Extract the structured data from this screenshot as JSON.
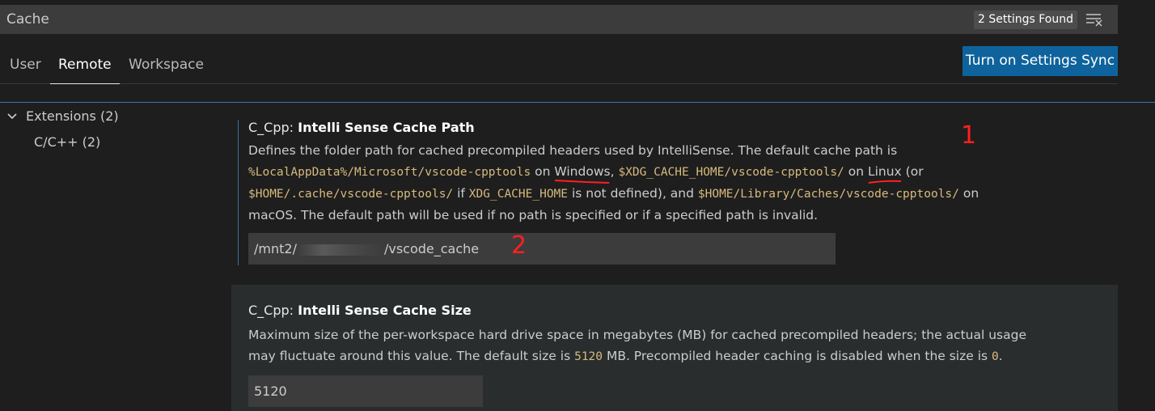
{
  "search": {
    "query": "Cache",
    "count": "2 Settings Found",
    "clear_icon": "clear-filter-icon"
  },
  "tabs": [
    {
      "label": "User",
      "active": false
    },
    {
      "label": "Remote",
      "active": true
    },
    {
      "label": "Workspace",
      "active": false
    }
  ],
  "sync_button": "Turn on Settings Sync",
  "toc": {
    "group": "Extensions (2)",
    "child": "C/C++ (2)"
  },
  "settings": [
    {
      "category": "C_Cpp: ",
      "name": "Intelli Sense Cache Path",
      "desc": {
        "p1": "Defines the folder path for cached precompiled headers used by IntelliSense. The default cache path is",
        "code1": "%LocalAppData%/Microsoft/vscode-cpptools",
        "t1": " on ",
        "win": "Windows",
        "t2": ", ",
        "code2": "$XDG_CACHE_HOME/vscode-cpptools/",
        "t3": " on ",
        "linux": "Linux",
        "t4": " (or",
        "code3": "$HOME/.cache/vscode-cpptools/",
        "t5": " if ",
        "code4": "XDG_CACHE_HOME",
        "t6": " is not defined), and ",
        "code5": "$HOME/Library/Caches/vscode-cpptools/",
        "t7": " on",
        "t8": "macOS. The default path will be used if no path is specified or if a specified path is invalid."
      },
      "value_prefix": "/mnt2/",
      "value_suffix": "/vscode_cache"
    },
    {
      "category": "C_Cpp: ",
      "name": "Intelli Sense Cache Size",
      "desc": {
        "l1": "Maximum size of the per-workspace hard drive space in megabytes (MB) for cached precompiled headers; the actual usage",
        "l2a": "may fluctuate around this value. The default size is ",
        "code1": "5120",
        "l2b": " MB. Precompiled header caching is disabled when the size is ",
        "code2": "0",
        "l2c": "."
      },
      "value": "5120"
    }
  ],
  "annotations": {
    "one": "1",
    "two": "2"
  }
}
